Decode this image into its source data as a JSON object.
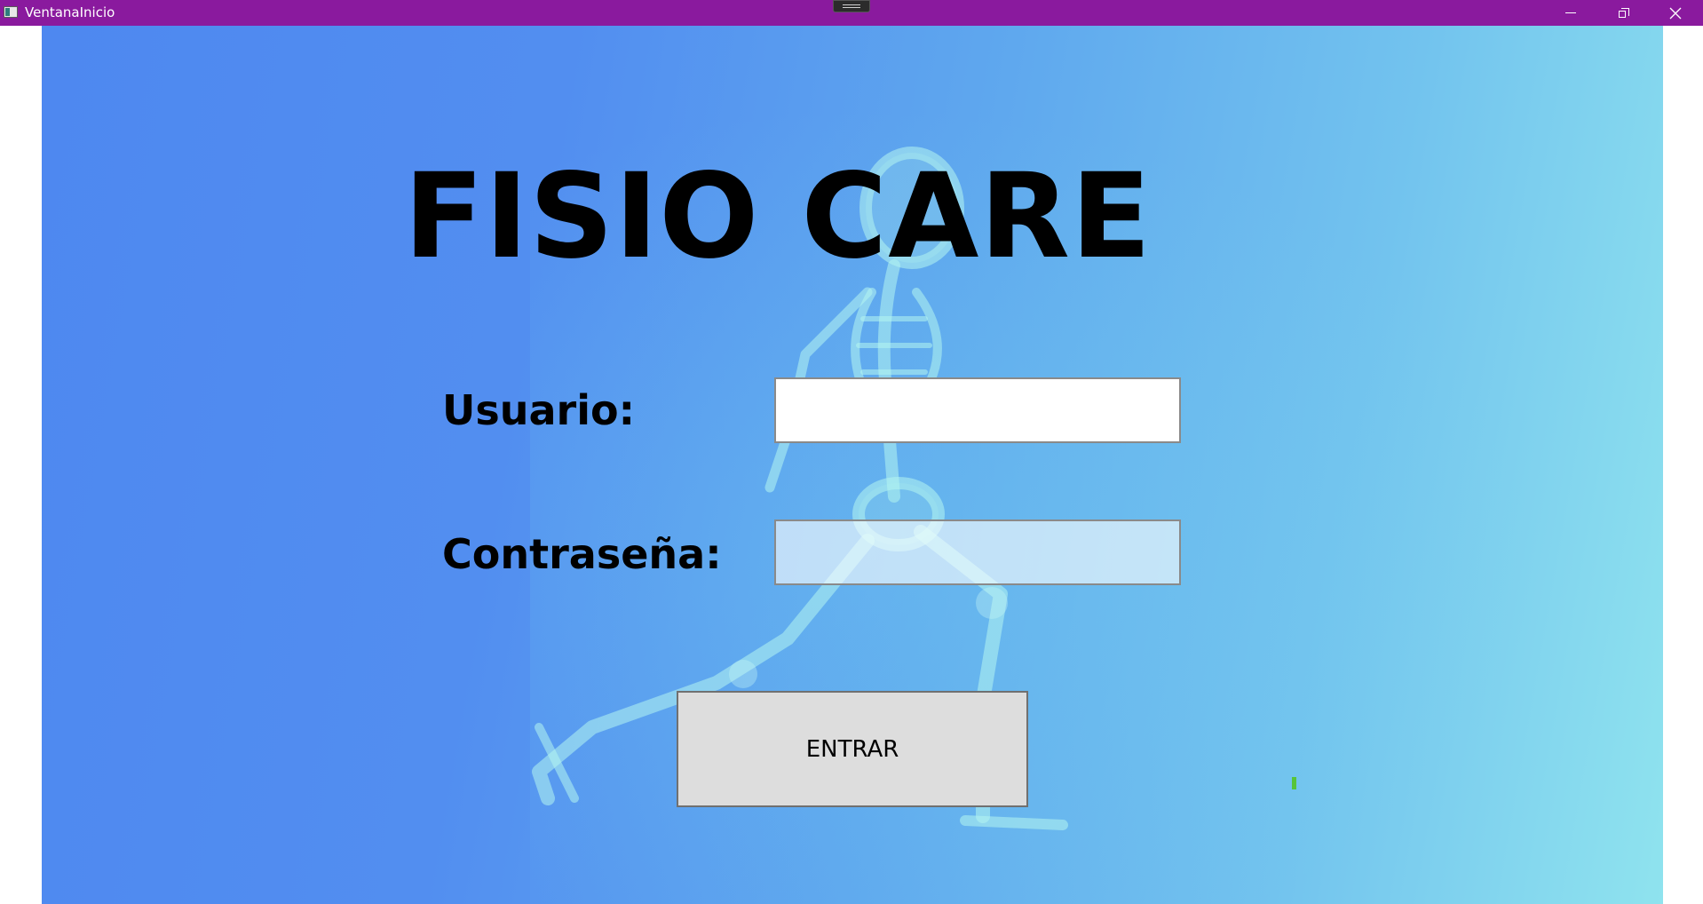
{
  "window": {
    "title": "VentanaInicio",
    "titlebar_color": "#8a1a9e"
  },
  "titlebar": {
    "icons": [
      "app-icon",
      "drag-handle",
      "minimize-icon",
      "restore-icon",
      "close-icon"
    ]
  },
  "main": {
    "app_title": "FISIO CARE",
    "background_image": "x-ray-running-skeleton",
    "user_label": "Usuario:",
    "user_value": "",
    "password_label": "Contraseña:",
    "password_value": "",
    "submit_label": "ENTRAR",
    "colors": {
      "background_start": "#4e88f0",
      "background_end": "#8fe3ee",
      "button_bg": "#dddddd"
    }
  }
}
